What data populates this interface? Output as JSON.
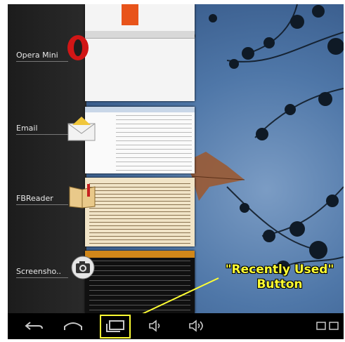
{
  "recent_apps": [
    {
      "label": "Opera Mini",
      "icon": "opera-icon"
    },
    {
      "label": "Email",
      "icon": "email-icon"
    },
    {
      "label": "FBReader",
      "icon": "fbreader-icon"
    },
    {
      "label": "Screensho..",
      "icon": "camera-icon"
    }
  ],
  "annotation": {
    "line1": "\"Recently Used\"",
    "line2": "Button",
    "color": "#ffff33"
  },
  "navbar": {
    "buttons": [
      "back-icon",
      "home-icon",
      "recent-apps-icon",
      "volume-down-icon",
      "volume-up-icon",
      "screenshot-icon"
    ]
  }
}
